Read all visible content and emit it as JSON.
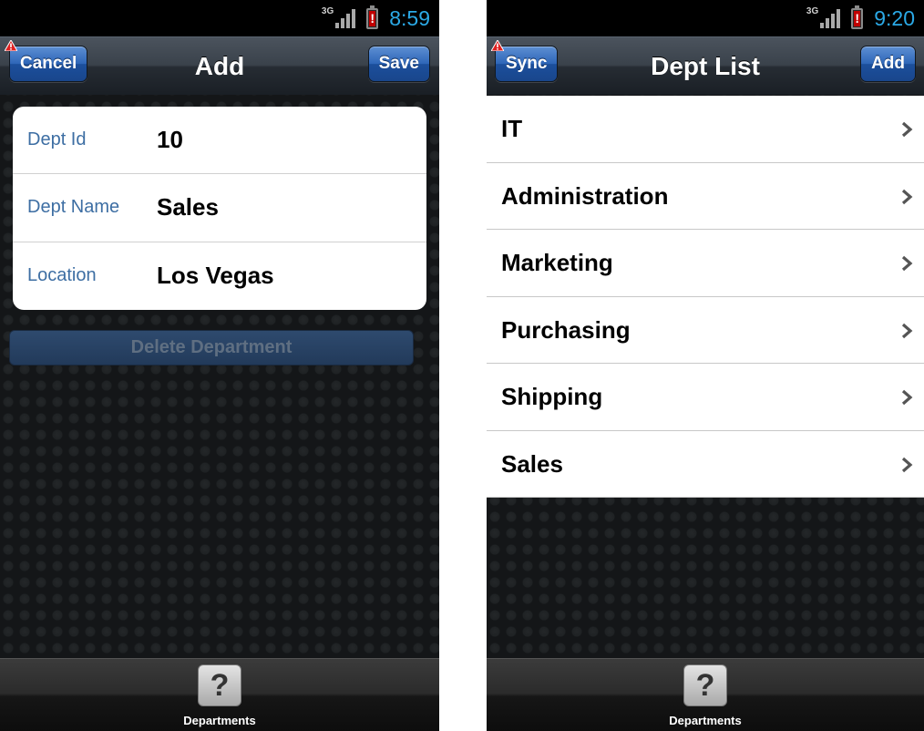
{
  "left_screen": {
    "status": {
      "network": "3G",
      "battery_alert": "!",
      "time": "8:59"
    },
    "navbar": {
      "title": "Add",
      "cancel_label": "Cancel",
      "save_label": "Save"
    },
    "form": {
      "rows": [
        {
          "label": "Dept Id",
          "value": "10"
        },
        {
          "label": "Dept Name",
          "value": "Sales"
        },
        {
          "label": "Location",
          "value": "Los Vegas"
        }
      ]
    },
    "delete_label": "Delete Department",
    "tabbar": {
      "icon_glyph": "?",
      "label": "Departments"
    }
  },
  "right_screen": {
    "status": {
      "network": "3G",
      "battery_alert": "!",
      "time": "9:20"
    },
    "navbar": {
      "title": "Dept List",
      "sync_label": "Sync",
      "add_label": "Add"
    },
    "list": [
      {
        "label": "IT"
      },
      {
        "label": "Administration"
      },
      {
        "label": "Marketing"
      },
      {
        "label": "Purchasing"
      },
      {
        "label": "Shipping"
      },
      {
        "label": "Sales"
      }
    ],
    "tabbar": {
      "icon_glyph": "?",
      "label": "Departments"
    }
  },
  "icons": {
    "status": [
      "signal-icon",
      "battery-icon"
    ],
    "navbar": "warning-icon",
    "list": "chevron-right-icon",
    "tabbar": "help-icon"
  },
  "colors": {
    "nav_button": "#2e66b8",
    "form_label": "#3d6ea3",
    "clock": "#2ba9e6",
    "warning": "#e02020",
    "battery_alert": "#c00000"
  }
}
